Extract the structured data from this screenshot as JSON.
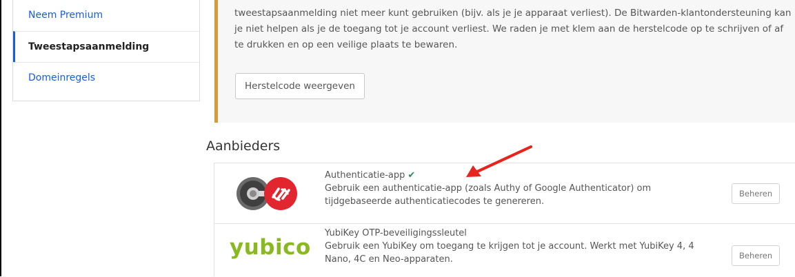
{
  "sidebar": {
    "items": [
      {
        "label": "Neem Premium"
      },
      {
        "label": "Tweestapsaanmelding"
      },
      {
        "label": "Domeinregels"
      }
    ]
  },
  "callout": {
    "text": "tweestapsaanmelding niet meer kunt gebruiken (bijv. als je je apparaat verliest). De Bitwarden-klantondersteuning kan je niet helpen als je de toegang tot je account verliest. We raden je met klem aan de herstelcode op te schrijven of af te drukken en op een veilige plaats te bewaren.",
    "button_label": "Herstelcode weergeven"
  },
  "providers": {
    "title": "Aanbieders",
    "items": [
      {
        "name": "Authenticatie-app",
        "enabled_mark": "✔",
        "description": "Gebruik een authenticatie-app (zoals Authy of Google Authenticator) om tijdgebaseerde authenticatiecodes te genereren.",
        "button_label": "Beheren",
        "logo": "authy-icon"
      },
      {
        "name": "YubiKey OTP-beveiligingssleutel",
        "description": "Gebruik een YubiKey om toegang te krijgen tot je account. Werkt met YubiKey 4, 4 Nano, 4C en Neo-apparaten.",
        "button_label": "Beheren",
        "logo_text": "yubico"
      }
    ]
  },
  "colors": {
    "link": "#175ddc",
    "callout_border": "#d89a35",
    "check": "#2e8b57",
    "yubico": "#8ab820",
    "annotation_arrow": "#e8231e"
  }
}
